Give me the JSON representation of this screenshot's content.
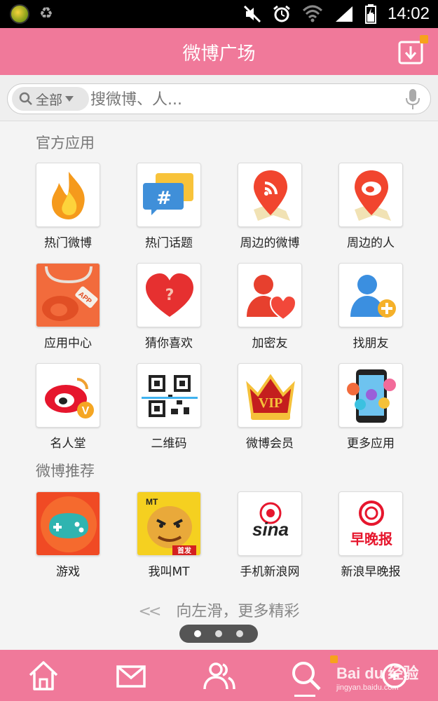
{
  "status_bar": {
    "time": "14:02"
  },
  "header": {
    "title": "微博广场"
  },
  "search": {
    "scope": "全部",
    "placeholder": "搜微博、人..."
  },
  "sections": {
    "official": {
      "title": "官方应用",
      "apps": [
        "热门微博",
        "热门话题",
        "周边的微博",
        "周边的人",
        "应用中心",
        "猜你喜欢",
        "加密友",
        "找朋友",
        "名人堂",
        "二维码",
        "微博会员",
        "更多应用"
      ]
    },
    "recommend": {
      "title": "微博推荐",
      "apps": [
        "游戏",
        "我叫MT",
        "手机新浪网",
        "新浪早晚报"
      ]
    }
  },
  "icon_text": {
    "app_tag": "APP",
    "hash": "#",
    "vip": "VIP",
    "v_badge": "V",
    "mt_badge": "首发",
    "mt_corner": "MT",
    "sina_logo": "sina",
    "zwb": "早晚报"
  },
  "hint": {
    "arrows": "<<",
    "text": "向左滑，更多精彩"
  },
  "watermark": {
    "line1": "Bai du 经验",
    "line2": "jingyan.baidu.com"
  },
  "colors": {
    "brand_pink": "#f0799a",
    "badge_orange": "#f7a21c"
  }
}
